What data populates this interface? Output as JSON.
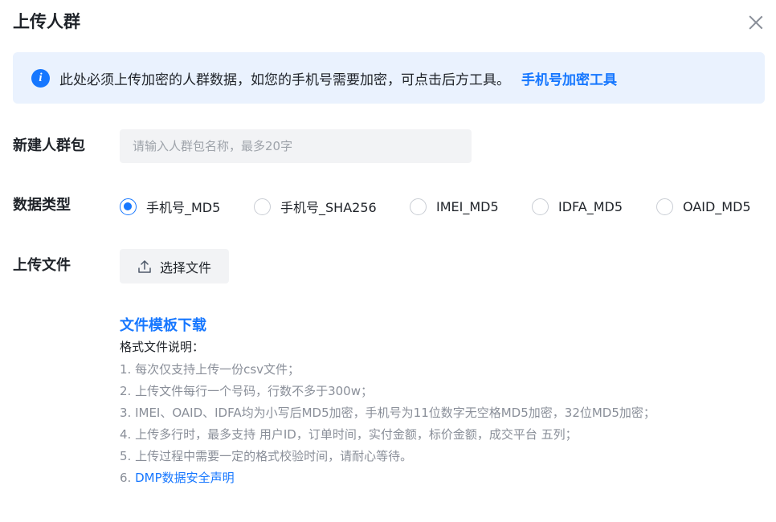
{
  "dialog": {
    "title": "上传人群"
  },
  "notice": {
    "text": "此处必须上传加密的人群数据，如您的手机号需要加密，可点击后方工具。",
    "link": "手机号加密工具"
  },
  "form": {
    "name_label": "新建人群包",
    "name_placeholder": "请输入人群包名称，最多20字",
    "type_label": "数据类型",
    "type_options": [
      "手机号_MD5",
      "手机号_SHA256",
      "IMEI_MD5",
      "IDFA_MD5",
      "OAID_MD5"
    ],
    "type_selected": "手机号_MD5",
    "upload_label": "上传文件",
    "upload_button": "选择文件"
  },
  "help": {
    "template_link": "文件模板下载",
    "title": "格式文件说明：",
    "items": [
      "1. 每次仅支持上传一份csv文件；",
      "2. 上传文件每行一个号码，行数不多于300w；",
      "3. IMEI、OAID、IDFA均为小写后MD5加密，手机号为11位数字无空格MD5加密，32位MD5加密；",
      "4. 上传多行时，最多支持 用户ID，订单时间，实付金额，标价金额，成交平台 五列；",
      "5. 上传过程中需要一定的格式校验时间，请耐心等待。"
    ],
    "item6_prefix": "6. ",
    "item6_link": "DMP数据安全声明"
  },
  "colors": {
    "accent": "#1677ff",
    "notice_bg": "#eaf2fe",
    "muted_text": "#8a8f99"
  }
}
